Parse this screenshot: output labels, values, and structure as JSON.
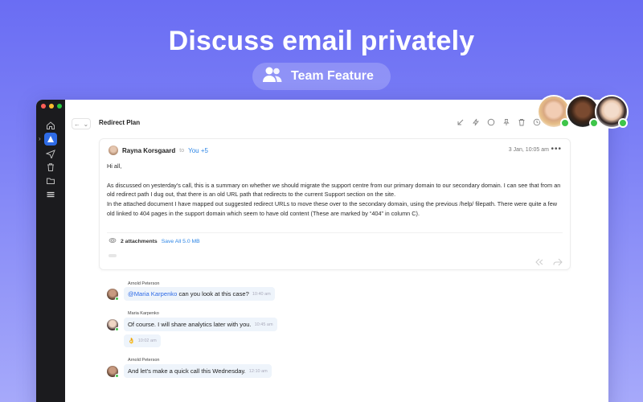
{
  "hero": {
    "title": "Discuss email privately",
    "pill_label": "Team Feature",
    "pill_icon": "users-icon"
  },
  "colors": {
    "accent": "#2e6be6",
    "link": "#2e86e6",
    "online": "#43c24a",
    "sidebar": "#1b1b1e"
  },
  "sidebar": {
    "items": [
      {
        "icon": "home-icon"
      },
      {
        "icon": "app-logo-icon",
        "active": true
      },
      {
        "icon": "send-icon"
      },
      {
        "icon": "trash-icon"
      },
      {
        "icon": "folder-icon"
      },
      {
        "icon": "menu-icon"
      }
    ]
  },
  "topbar": {
    "subject": "Redirect Plan",
    "toolbar_icons": [
      "archive-down-icon",
      "bolt-icon",
      "circle-icon",
      "pin-icon",
      "delete-icon",
      "clock-icon"
    ]
  },
  "email": {
    "sender": "Rayna Korsgaard",
    "to_label": "to",
    "recipients": "You +5",
    "date": "3 Jan, 10:05 am",
    "more": "•••",
    "greeting": "Hi all,",
    "paragraph1": "As discussed on yesterday's call, this is a summary on whether we should migrate the support centre from our primary domain to our secondary domain. I can see that from an old redirect path I dug out, that there is an old URL path that redirects to the current Support section on the site.",
    "paragraph2": "In the attached document I have mapped out suggested redirect URLs to move these over to the secondary domain, using the previous /help/ filepath. There were quite a few old linked to 404 pages in the support domain which seem to have old content (These are marked by “404” in column C).",
    "attachments_count": "2 attachments",
    "save_all": "Save All 5.0 MB"
  },
  "chat": [
    {
      "name": "Arnold Peterson",
      "mention": "@Maria Karpenko",
      "text": " can you look at this case?",
      "time": "10:40 am"
    },
    {
      "name": "Maria Karpenko",
      "mention": "",
      "text": "Of course. I will share analytics later with you.",
      "time": "10:45 am"
    },
    {
      "name": "",
      "mention": "",
      "text": "👌",
      "time": "10:02 am"
    },
    {
      "name": "Arnold Peterson",
      "mention": "",
      "text": "And let's make a quick call this Wednesday.",
      "time": "12:10 am"
    }
  ]
}
